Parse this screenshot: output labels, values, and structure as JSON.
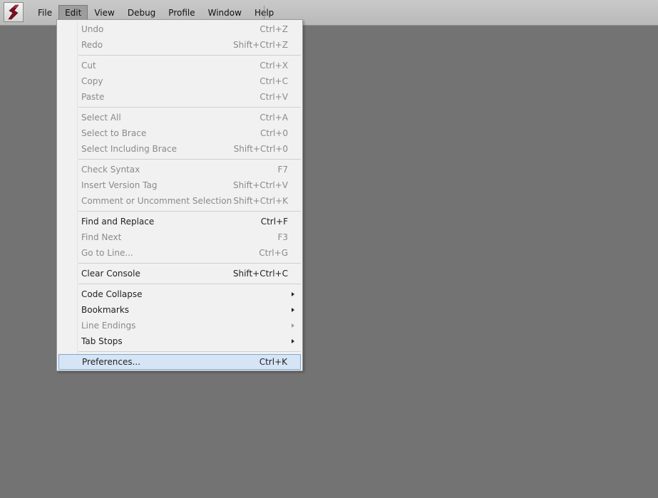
{
  "menubar": {
    "logo_icon": "app-logo-icon",
    "menus": [
      "File",
      "Edit",
      "View",
      "Debug",
      "Profile",
      "Window",
      "Help"
    ],
    "open_menu": "Edit"
  },
  "edit_menu": {
    "groups": [
      [
        {
          "label": "Undo",
          "shortcut": "Ctrl+Z",
          "enabled": false
        },
        {
          "label": "Redo",
          "shortcut": "Shift+Ctrl+Z",
          "enabled": false
        }
      ],
      [
        {
          "label": "Cut",
          "shortcut": "Ctrl+X",
          "enabled": false
        },
        {
          "label": "Copy",
          "shortcut": "Ctrl+C",
          "enabled": false
        },
        {
          "label": "Paste",
          "shortcut": "Ctrl+V",
          "enabled": false
        }
      ],
      [
        {
          "label": "Select All",
          "shortcut": "Ctrl+A",
          "enabled": false
        },
        {
          "label": "Select to Brace",
          "shortcut": "Ctrl+0",
          "enabled": false
        },
        {
          "label": "Select Including Brace",
          "shortcut": "Shift+Ctrl+0",
          "enabled": false
        }
      ],
      [
        {
          "label": "Check Syntax",
          "shortcut": "F7",
          "enabled": false
        },
        {
          "label": "Insert Version Tag",
          "shortcut": "Shift+Ctrl+V",
          "enabled": false
        },
        {
          "label": "Comment or Uncomment Selection",
          "shortcut": "Shift+Ctrl+K",
          "enabled": false
        }
      ],
      [
        {
          "label": "Find and Replace",
          "shortcut": "Ctrl+F",
          "enabled": true
        },
        {
          "label": "Find Next",
          "shortcut": "F3",
          "enabled": false
        },
        {
          "label": "Go to Line...",
          "shortcut": "Ctrl+G",
          "enabled": false
        }
      ],
      [
        {
          "label": "Clear Console",
          "shortcut": "Shift+Ctrl+C",
          "enabled": true
        }
      ],
      [
        {
          "label": "Code Collapse",
          "submenu": true,
          "enabled": true
        },
        {
          "label": "Bookmarks",
          "submenu": true,
          "enabled": true
        },
        {
          "label": "Line Endings",
          "submenu": true,
          "enabled": false
        },
        {
          "label": "Tab Stops",
          "submenu": true,
          "enabled": true
        }
      ],
      [
        {
          "label": "Preferences...",
          "shortcut": "Ctrl+K",
          "enabled": true,
          "highlighted": true
        }
      ]
    ]
  },
  "colors": {
    "workspace_bg": "#737373",
    "menubar_bg": "#c0c0c0",
    "menu_bg": "#f1f1f1",
    "highlight_bg": "#d6e5f5",
    "highlight_border": "#7fa7d3",
    "disabled_text": "#8a8a8a",
    "logo_red": "#7a1020"
  }
}
